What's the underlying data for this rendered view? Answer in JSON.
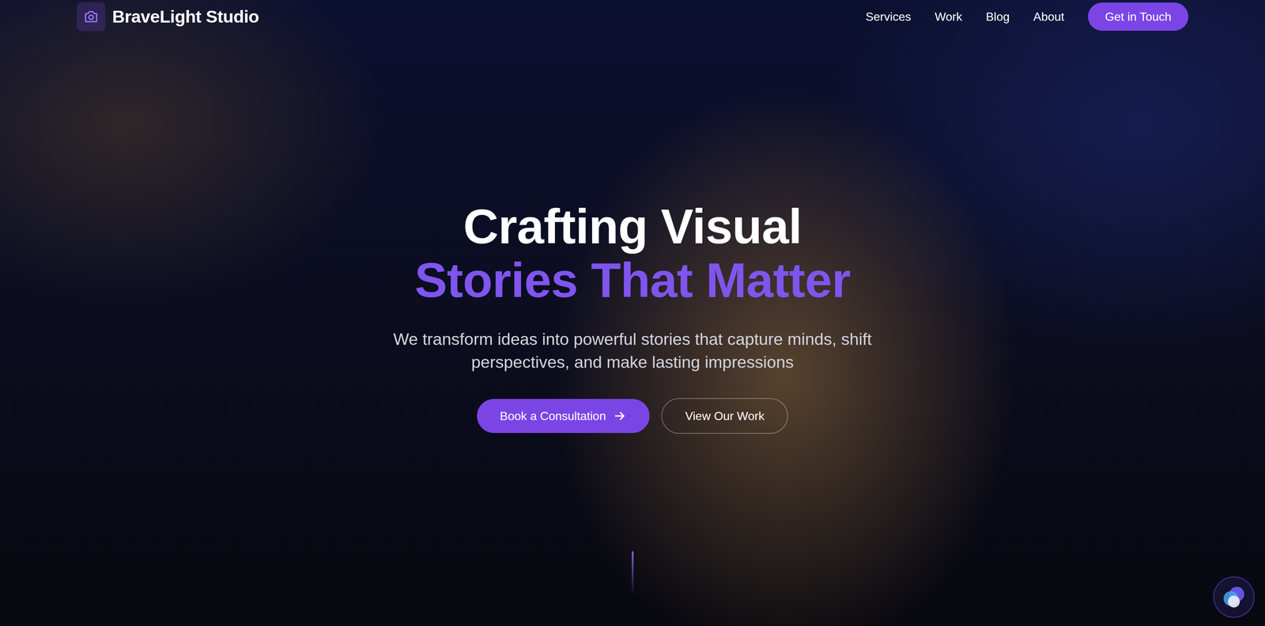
{
  "brand": {
    "name": "BraveLight Studio"
  },
  "nav": {
    "links": [
      {
        "label": "Services"
      },
      {
        "label": "Work"
      },
      {
        "label": "Blog"
      },
      {
        "label": "About"
      }
    ],
    "cta": "Get in Touch"
  },
  "hero": {
    "title_line1": "Crafting Visual",
    "title_line2": "Stories That Matter",
    "subtitle": "We transform ideas into powerful stories that capture minds, shift perspectives, and make lasting impressions",
    "primary_button": "Book a Consultation",
    "secondary_button": "View Our Work"
  }
}
